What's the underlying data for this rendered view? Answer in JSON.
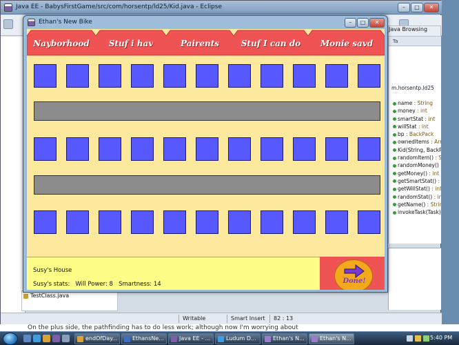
{
  "eclipse": {
    "title": "Java EE - BabysFirstGame/src/com/horsentp/ld25/Kid.java - Eclipse",
    "perspective": "Java Browsing",
    "outline_tabs": "Ta",
    "outline_package": "m.horsentp.ld25",
    "outline": [
      {
        "name": "name",
        "type": " : String"
      },
      {
        "name": "money",
        "type": " : int"
      },
      {
        "name": "smartStat",
        "type": " : int"
      },
      {
        "name": "willStat",
        "type": " : int"
      },
      {
        "name": "bp",
        "type": " : BackPack"
      },
      {
        "name": "ownedItems",
        "type": " : Arra"
      },
      {
        "name": "Kid(String, BackPa",
        "type": ""
      },
      {
        "name": "randomItem()",
        "type": " : St"
      },
      {
        "name": "randomMoney()",
        "type": " :"
      },
      {
        "name": "getMoney()",
        "type": " : int"
      },
      {
        "name": "getSmartStat()",
        "type": " : in"
      },
      {
        "name": "getWillStat()",
        "type": " : int"
      },
      {
        "name": "randomStat()",
        "type": " : int"
      },
      {
        "name": "getName()",
        "type": " : String"
      },
      {
        "name": "invokeTask(Task)",
        "type": ""
      }
    ],
    "file_label": "TestClass.java",
    "status": {
      "writable": "Writable",
      "insert": "Smart Insert",
      "pos": "82 : 13"
    }
  },
  "blog_text": "On the plus side, the pathfinding has to do less work; although now I'm worrying about",
  "game": {
    "title": "Ethan's New Bike",
    "tabs": [
      "Nayborhood",
      "Stuf i hav",
      "Pairents",
      "Stuf I can do",
      "Monie savd"
    ],
    "location": "Susy's House",
    "stats_prefix": "Susy's stats:",
    "will_label": "Will Power:",
    "will_value": "8",
    "smart_label": "Smartness:",
    "smart_value": "14",
    "done_label": "Done!"
  },
  "taskbar": {
    "tasks": [
      "endOfDay...",
      "EthansNe...",
      "Java EE - ...",
      "Ludum D...",
      "Ethan's N...",
      "Ethan's N..."
    ],
    "clock": "5:40 PM"
  }
}
